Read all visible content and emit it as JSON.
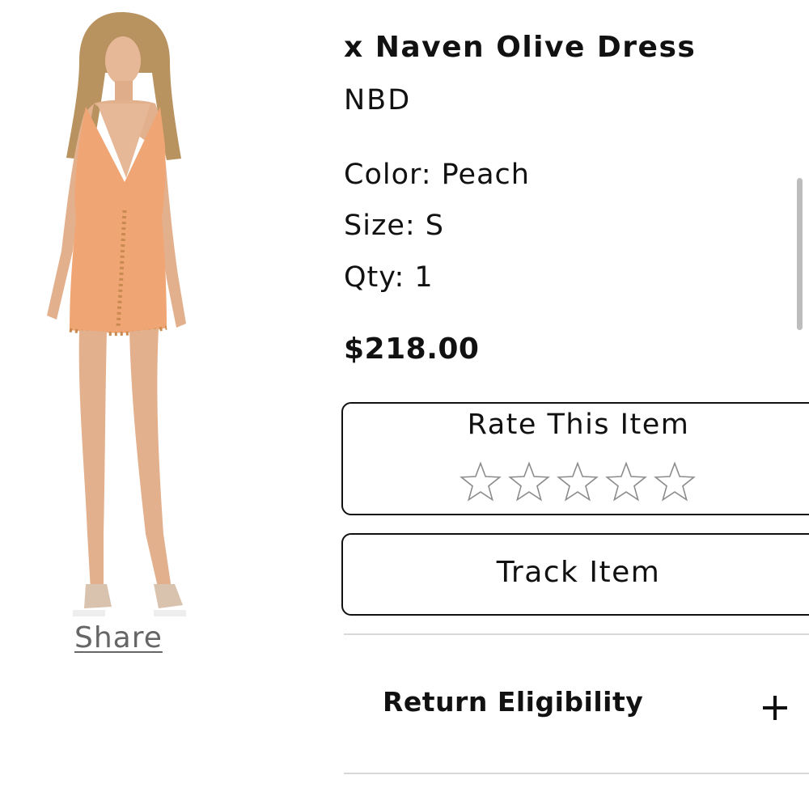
{
  "product": {
    "title": "x Naven Olive Dress",
    "brand": "NBD",
    "color_line": "Color: Peach",
    "size_line": "Size: S",
    "qty_line": "Qty: 1",
    "price": "$218.00",
    "dress_color": "#f0a575",
    "image_icon": "model-in-dress-photo"
  },
  "share": {
    "label": "Share"
  },
  "rating": {
    "title": "Rate This Item",
    "max_stars": 5,
    "selected": 0,
    "star_icon": "star-outline-icon"
  },
  "track": {
    "label": "Track Item"
  },
  "return_section": {
    "label": "Return Eligibility",
    "expand_icon": "plus-icon",
    "expanded": false
  },
  "colors": {
    "text": "#111111",
    "muted_link": "#666666",
    "divider": "#d8d8d8",
    "star_stroke": "#8a8a8a",
    "scrollbar": "#bdbdbd"
  }
}
